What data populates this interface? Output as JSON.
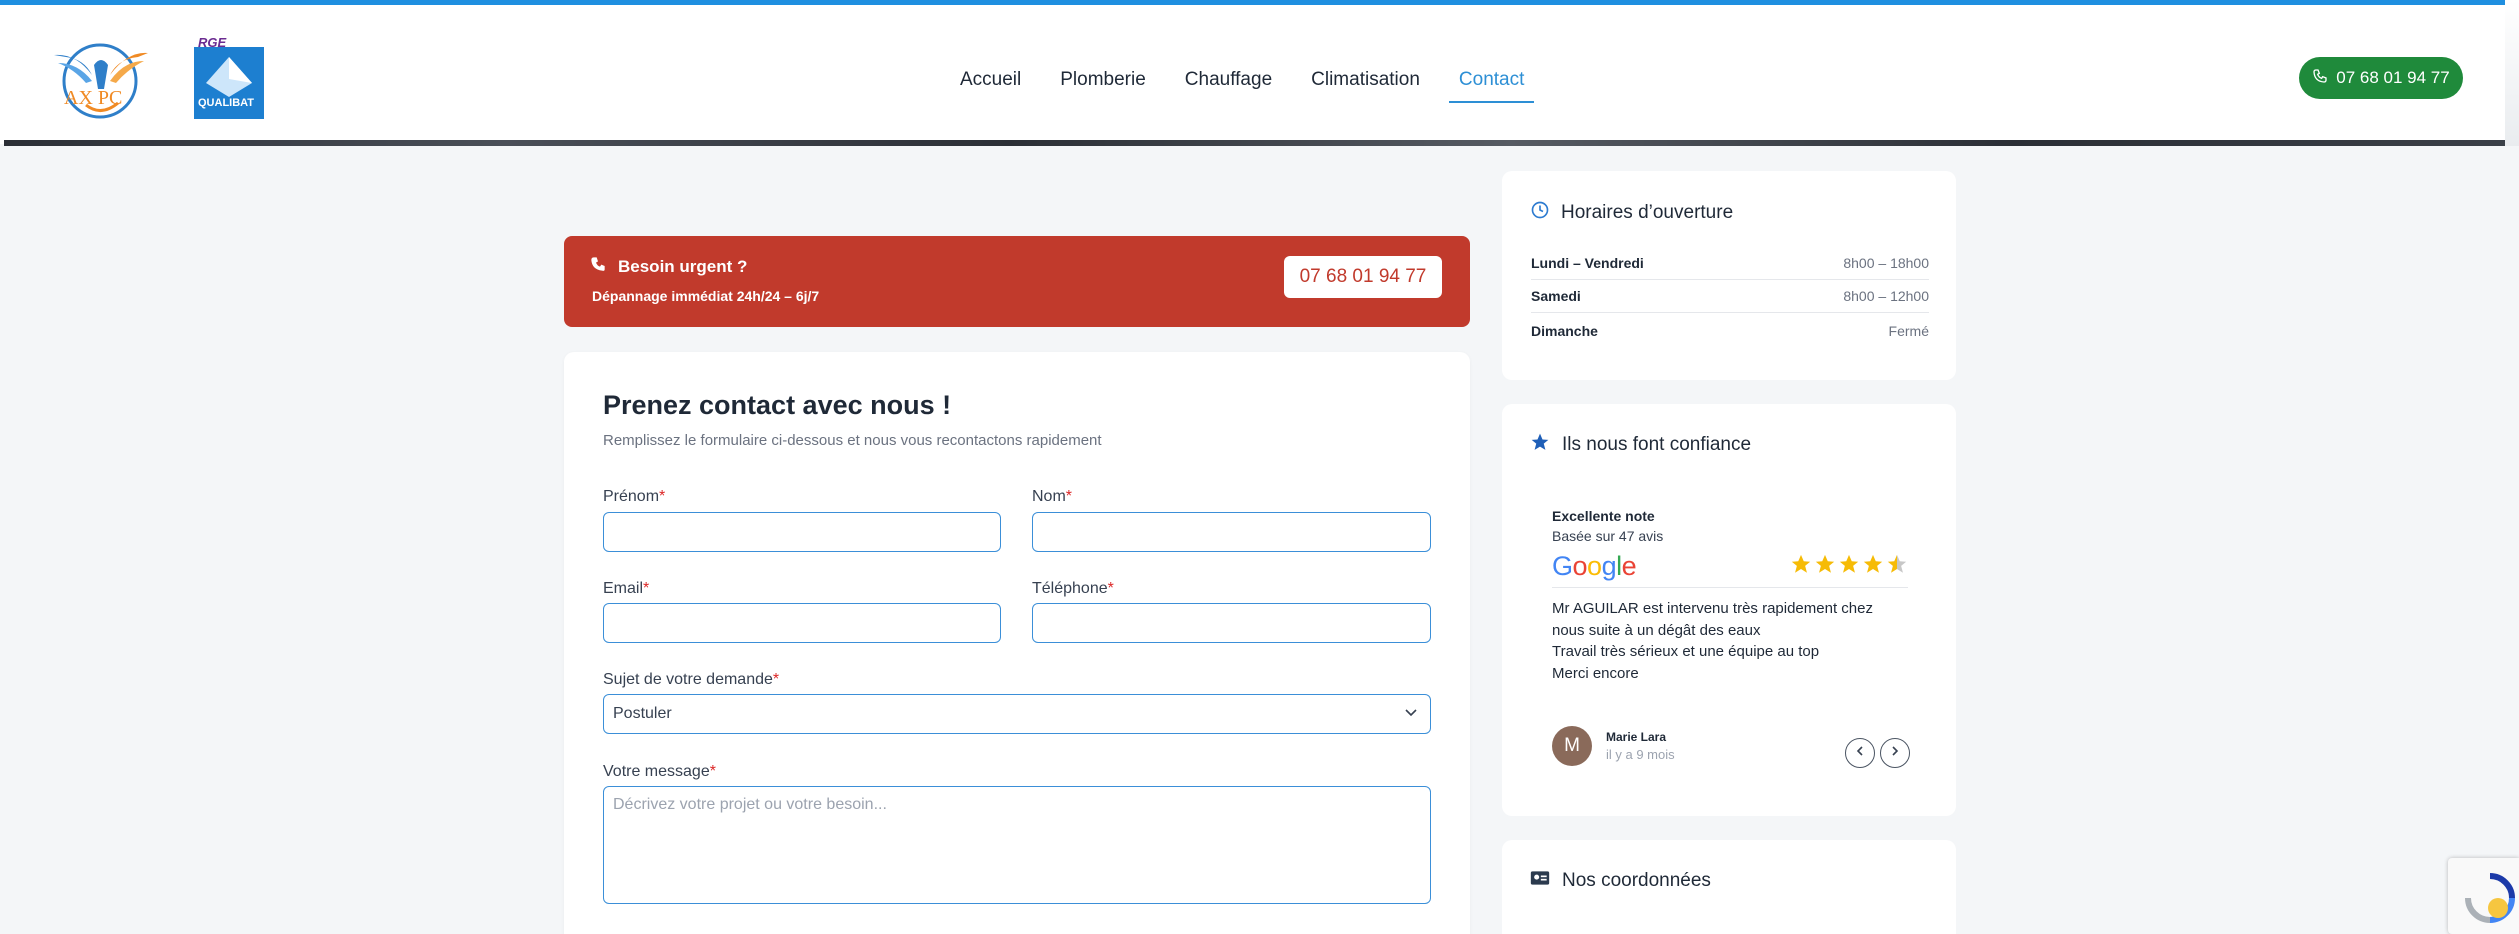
{
  "header": {
    "logo_text": "AX PC",
    "rge_badge_top": "RGE",
    "rge_badge_bottom": "QUALIBAT",
    "nav": [
      {
        "label": "Accueil"
      },
      {
        "label": "Plomberie"
      },
      {
        "label": "Chauffage"
      },
      {
        "label": "Climatisation"
      },
      {
        "label": "Contact",
        "active": true
      }
    ],
    "phone": "07 68 01 94 77"
  },
  "urgent": {
    "title": "Besoin urgent ?",
    "subtitle": "Dépannage immédiat 24h/24 – 6j/7",
    "phone": "07 68 01 94 77"
  },
  "form": {
    "title": "Prenez contact avec nous !",
    "subtitle": "Remplissez le formulaire ci-dessous et nous vous recontactons rapidement",
    "first_name_label": "Prénom",
    "last_name_label": "Nom",
    "email_label": "Email",
    "phone_label": "Téléphone",
    "subject_label": "Sujet de votre demande",
    "subject_value": "Postuler",
    "message_label": "Votre message",
    "message_placeholder": "Décrivez votre projet ou votre besoin...",
    "required_mark": "*"
  },
  "hours": {
    "title": "Horaires d’ouverture",
    "rows": [
      {
        "day": "Lundi – Vendredi",
        "time": "8h00 – 18h00"
      },
      {
        "day": "Samedi",
        "time": "8h00 – 12h00"
      },
      {
        "day": "Dimanche",
        "time": "Fermé"
      }
    ]
  },
  "reviews": {
    "title": "Ils nous font confiance",
    "rating_label": "Excellente note",
    "basis": "Basée sur 47 avis",
    "google": "Google",
    "rating": 4.5,
    "text_lines": [
      "Mr AGUILAR est intervenu très rapidement chez",
      "nous suite à un dégât des eaux",
      "Travail très sérieux et une équipe au top",
      "Merci encore"
    ],
    "author_initial": "M",
    "author": "Marie Lara",
    "date": "il y a 9 mois"
  },
  "contact": {
    "title": "Nos coordonnées"
  },
  "colors": {
    "accent": "#2d8fd5",
    "phone_green": "#1f8a3b",
    "urgent_red": "#c13a2c"
  }
}
